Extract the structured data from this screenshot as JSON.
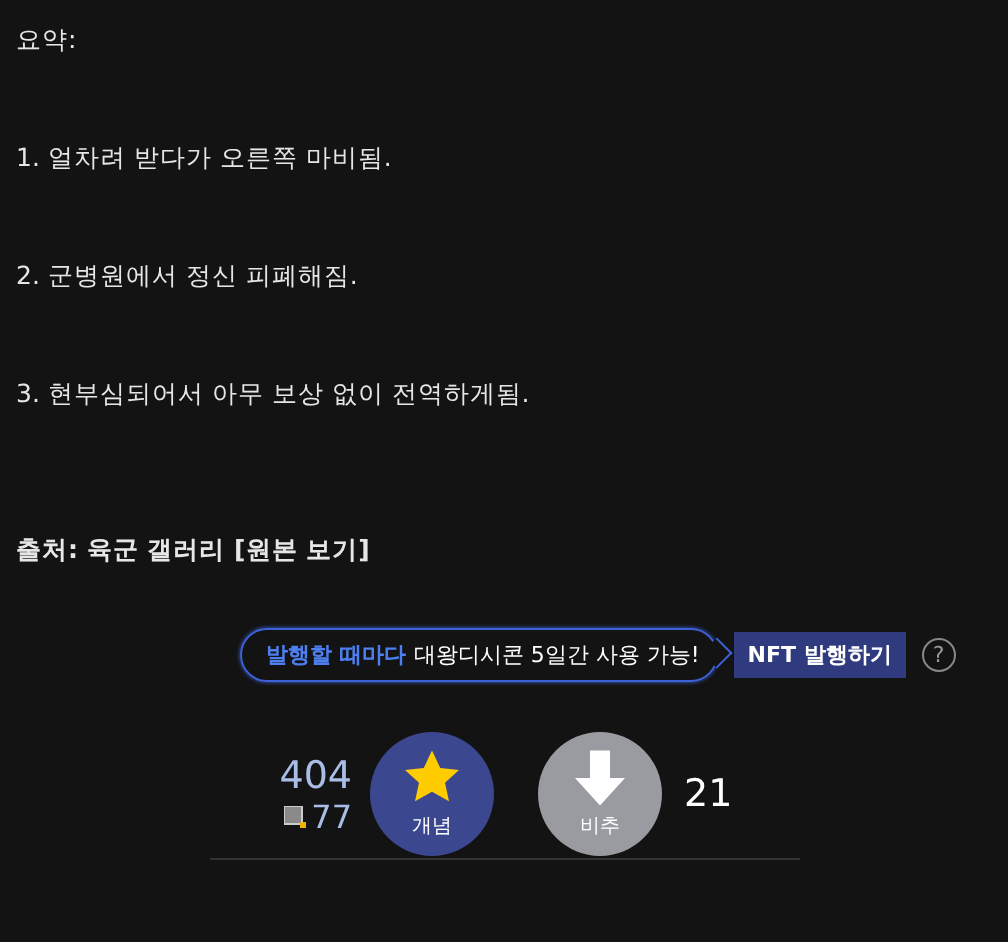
{
  "paragraphs": [
    {
      "text": "요약:",
      "bold": false
    },
    {
      "text": "1. 얼차려 받다가 오른쪽 마비됨.",
      "bold": false
    },
    {
      "text": "2. 군병원에서 정신 피폐해짐.",
      "bold": false
    },
    {
      "text": "3. 현부심되어서 아무 보상 없이 전역하게됨.",
      "bold": false
    },
    {
      "text": "출처: 육군 갤러리 [원본 보기]",
      "bold": true
    }
  ],
  "nft": {
    "highlight": "발행할 때마다",
    "message": "대왕디시콘 5일간 사용 가능!",
    "button": "NFT 발행하기",
    "help": "?"
  },
  "votes": {
    "up_count": "404",
    "fixed_count": "77",
    "up_label": "개념",
    "down_label": "비추",
    "down_count": "21"
  }
}
